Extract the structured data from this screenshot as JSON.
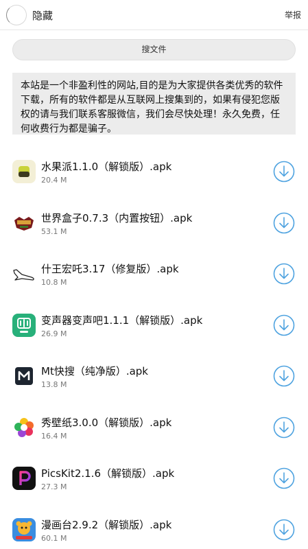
{
  "header": {
    "title": "隐藏",
    "report": "举报"
  },
  "search": {
    "label": "搜文件"
  },
  "notice": {
    "text": "本站是一个非盈利性的网站,目的是为大家提供各类优秀的软件下载，所有的软件都是从互联网上搜集到的，如果有侵犯您版权的请与我们联系客服微信，我们会尽快处理！永久免费，任何收费行为都是骗子。"
  },
  "apps": [
    {
      "name": "水果派1.1.0（解锁版）.apk",
      "size": "20.4 M",
      "icon": "fruit-app-icon"
    },
    {
      "name": "世界盒子0.7.3（内置按钮）.apk",
      "size": "53.1 M",
      "icon": "world-box-icon"
    },
    {
      "name": "什王宏吒3.17（修复版）.apk",
      "size": "10.8 M",
      "icon": "airplane-icon"
    },
    {
      "name": "变声器变声吧1.1.1（解锁版）.apk",
      "size": "26.9 M",
      "icon": "voice-changer-icon"
    },
    {
      "name": "Mt快搜（纯净版）.apk",
      "size": "13.8 M",
      "icon": "mt-search-icon"
    },
    {
      "name": "秀壁纸3.0.0（解锁版）.apk",
      "size": "16.4 M",
      "icon": "wallpaper-icon"
    },
    {
      "name": "PicsKit2.1.6（解锁版）.apk",
      "size": "27.3 M",
      "icon": "picskit-icon"
    },
    {
      "name": "漫画台2.9.2（解锁版）.apk",
      "size": "60.1 M",
      "icon": "comic-icon"
    }
  ],
  "colors": {
    "accent": "#4fa3e0",
    "panel": "#ececec"
  }
}
